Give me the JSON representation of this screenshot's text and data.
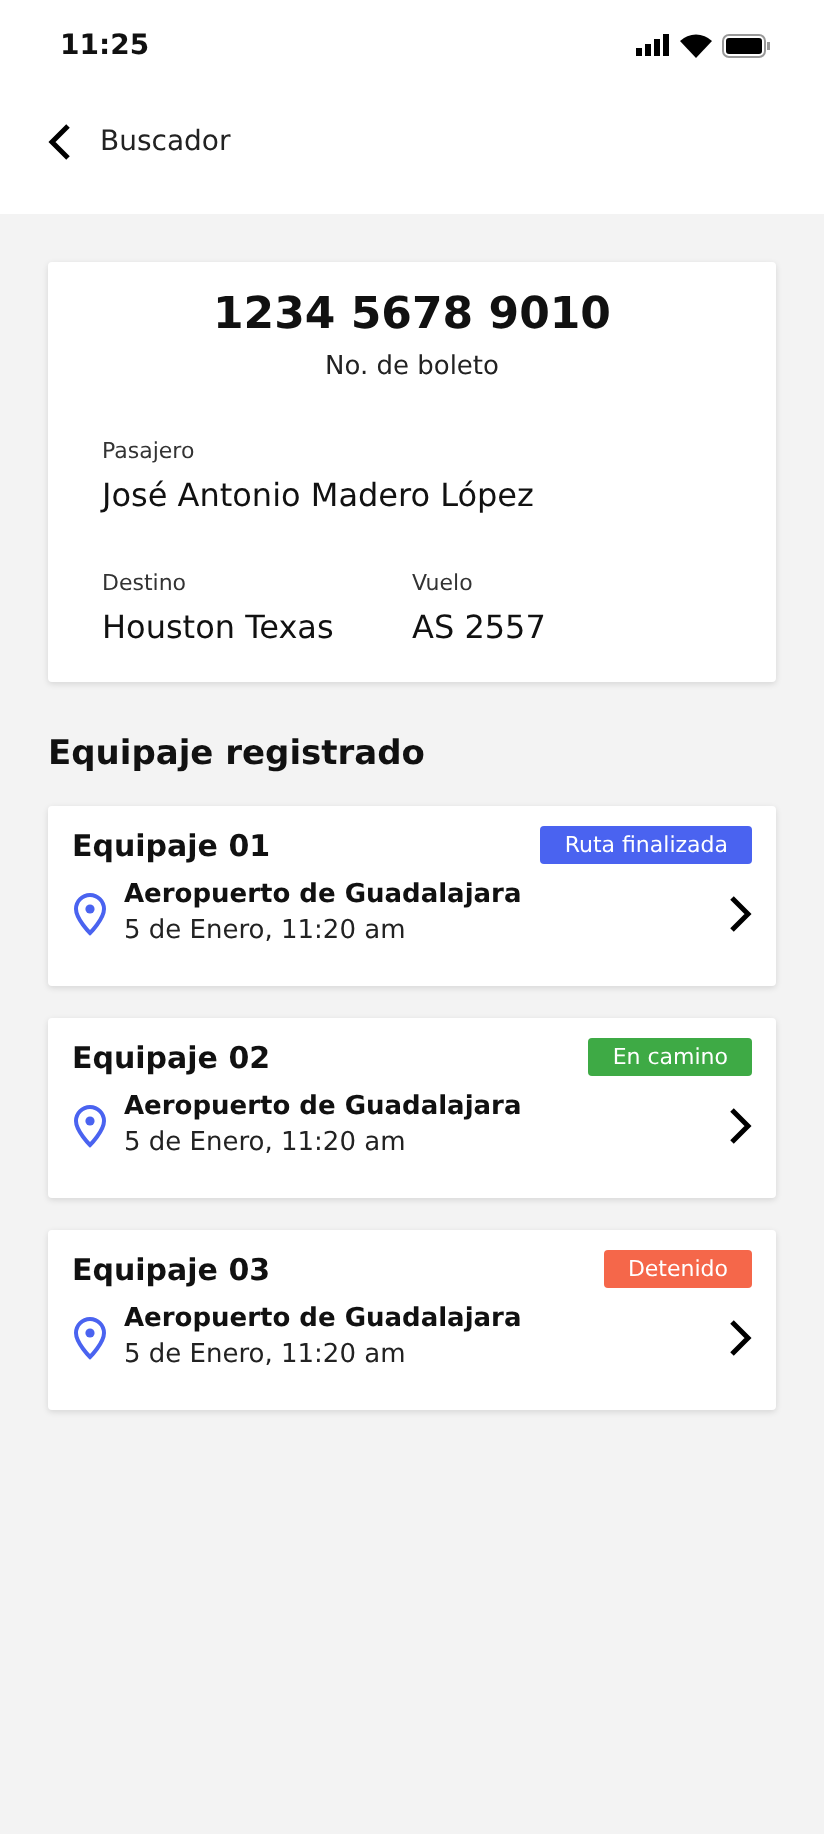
{
  "status_bar": {
    "time": "11:25"
  },
  "header": {
    "back_label": "Buscador"
  },
  "ticket": {
    "number": "1234 5678 9010",
    "number_label": "No. de boleto",
    "passenger_label": "Pasajero",
    "passenger": "José Antonio Madero López",
    "destination_label": "Destino",
    "destination": "Houston Texas",
    "flight_label": "Vuelo",
    "flight": "AS 2557"
  },
  "section_title": "Equipaje registrado",
  "baggage": [
    {
      "name": "Equipaje 01",
      "status": "Ruta finalizada",
      "color": "#4a63f0",
      "location": "Aeropuerto de Guadalajara",
      "date": "5 de Enero, 11:20 am"
    },
    {
      "name": "Equipaje 02",
      "status": "En camino",
      "color": "#3eaa45",
      "location": "Aeropuerto de Guadalajara",
      "date": "5 de Enero, 11:20 am"
    },
    {
      "name": "Equipaje 03",
      "status": "Detenido",
      "color": "#f5674a",
      "location": "Aeropuerto de Guadalajara",
      "date": "5 de Enero, 11:20 am"
    }
  ]
}
